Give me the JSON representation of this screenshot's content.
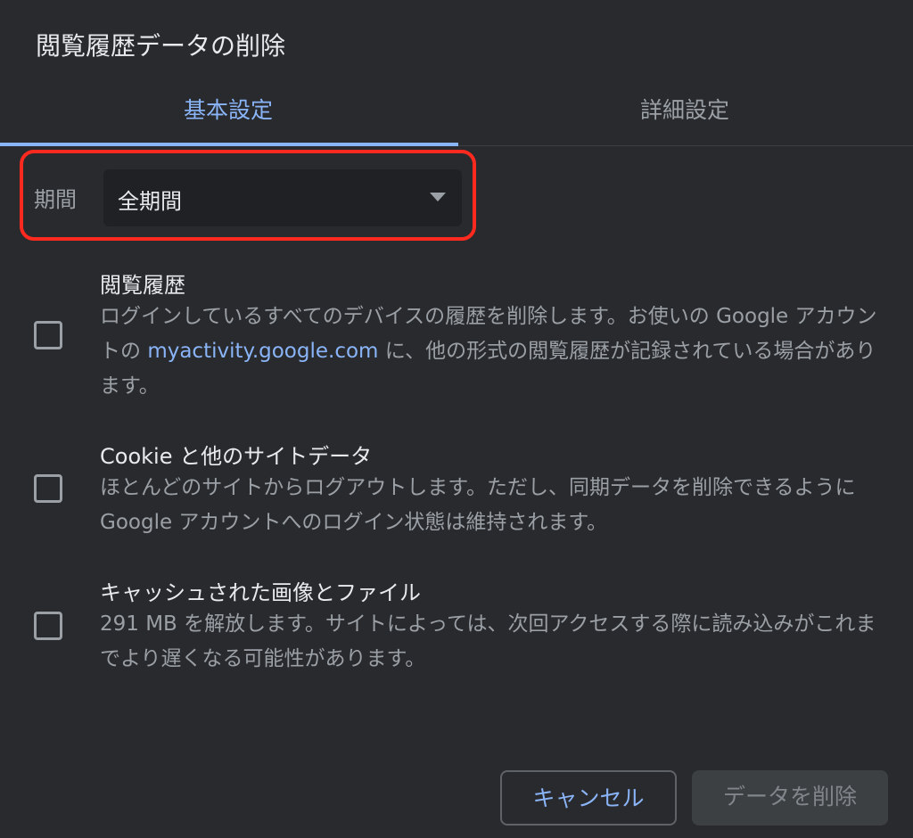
{
  "dialog": {
    "title": "閲覧履歴データの削除"
  },
  "tabs": [
    {
      "label": "基本設定",
      "active": true
    },
    {
      "label": "詳細設定",
      "active": false
    }
  ],
  "period": {
    "label": "期間",
    "value": "全期間"
  },
  "options": [
    {
      "title": "閲覧履歴",
      "checked": false,
      "desc_before": "ログインしているすべてのデバイスの履歴を削除します。お使いの Google アカウントの ",
      "link": "myactivity.google.com",
      "desc_after": " に、他の形式の閲覧履歴が記録されている場合があります。"
    },
    {
      "title": "Cookie と他のサイトデータ",
      "checked": false,
      "desc": "ほとんどのサイトからログアウトします。ただし、同期データを削除できるように Google アカウントへのログイン状態は維持されます。"
    },
    {
      "title": "キャッシュされた画像とファイル",
      "checked": false,
      "desc": "291 MB を解放します。サイトによっては、次回アクセスする際に読み込みがこれまでより遅くなる可能性があります。"
    }
  ],
  "buttons": {
    "cancel": "キャンセル",
    "delete": "データを削除"
  },
  "colors": {
    "background": "#292a2d",
    "accent": "#8ab4f8",
    "highlight": "#ff2a1f"
  }
}
